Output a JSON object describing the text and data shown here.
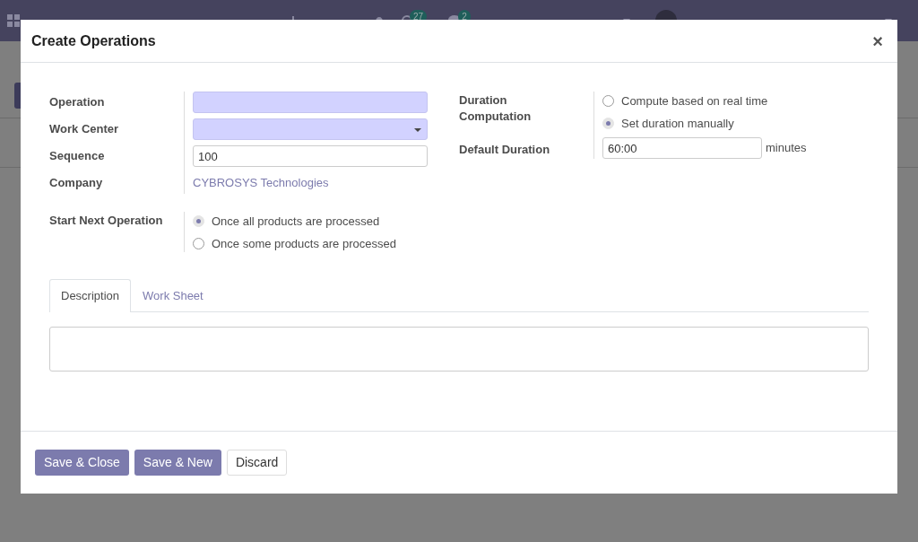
{
  "background": {
    "activity_count": "27",
    "message_count": "2"
  },
  "dialog": {
    "title": "Create Operations",
    "close": "×"
  },
  "left_fields": [
    {
      "label": "Operation",
      "kind": "text",
      "required": true
    },
    {
      "label": "Work Center",
      "kind": "select",
      "required": true
    },
    {
      "label": "Sequence",
      "kind": "text",
      "required": false,
      "value": "100"
    },
    {
      "label": "Company",
      "kind": "link",
      "value": "CYBROSYS Technologies"
    }
  ],
  "start_next": {
    "label": "Start Next Operation",
    "options": [
      {
        "label": "Once all products are processed",
        "selected": true
      },
      {
        "label": "Once some products are processed",
        "selected": false
      }
    ]
  },
  "duration_computation": {
    "label": "Duration Computation",
    "options": [
      {
        "label": "Compute based on real time",
        "selected": false
      },
      {
        "label": "Set duration manually",
        "selected": true
      }
    ]
  },
  "default_duration": {
    "label": "Default Duration",
    "value": "60:00",
    "unit": "minutes"
  },
  "tabs": [
    {
      "label": "Description",
      "selected": true
    },
    {
      "label": "Work Sheet",
      "selected": false
    }
  ],
  "buttons": [
    {
      "label": "Save & Close",
      "kind": "primary"
    },
    {
      "label": "Save & New",
      "kind": "primary"
    },
    {
      "label": "Discard",
      "kind": "secondary"
    }
  ]
}
